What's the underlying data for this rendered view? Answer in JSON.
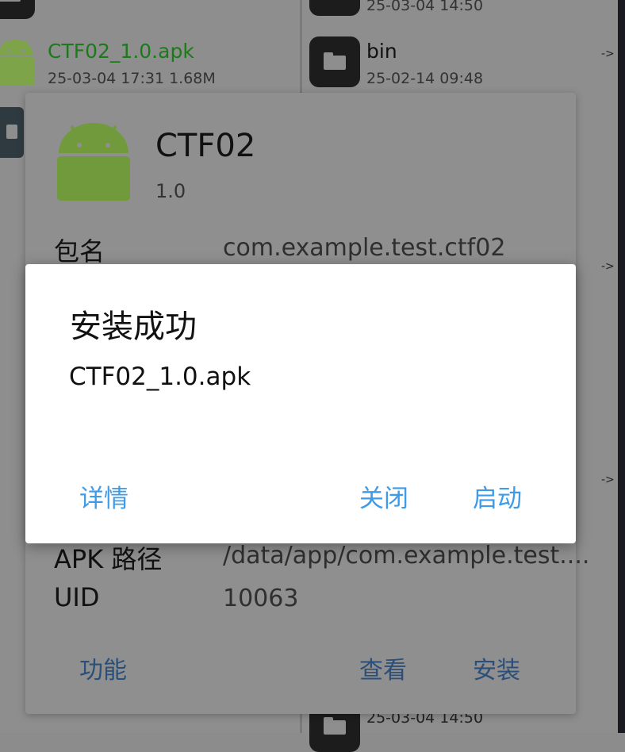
{
  "left_pane": {
    "apk_file": {
      "name": "CTF02_1.0.apk",
      "meta": "25-03-04 17:31  1.68M"
    }
  },
  "right_pane": {
    "top_entry_meta": "25-03-04 14:50",
    "bin": {
      "name": "bin",
      "meta": "25-02-14 09:48",
      "arrow": "->"
    },
    "arrow_2": "->",
    "arrow_3": "->",
    "bottom_entry_meta": "25-03-04 14:50"
  },
  "app_info": {
    "app_name": "CTF02",
    "version": "1.0",
    "package_label": "包名",
    "package_value": "com.example.test.ctf02",
    "apk_path_label": "APK 路径",
    "apk_path_value": "/data/app/com.example.test....",
    "uid_label": "UID",
    "uid_value": "10063",
    "buttons": {
      "functions": "功能",
      "view": "查看",
      "install": "安装"
    }
  },
  "dialog": {
    "title": "安装成功",
    "message": "CTF02_1.0.apk",
    "buttons": {
      "details": "详情",
      "close": "关闭",
      "launch": "启动"
    }
  },
  "colors": {
    "accent": "#3d9be9",
    "apk_green": "#7cb342",
    "apk_name_green": "#1b7a1b"
  },
  "icons": [
    "folder-icon",
    "android-app-icon",
    "document-icon"
  ]
}
